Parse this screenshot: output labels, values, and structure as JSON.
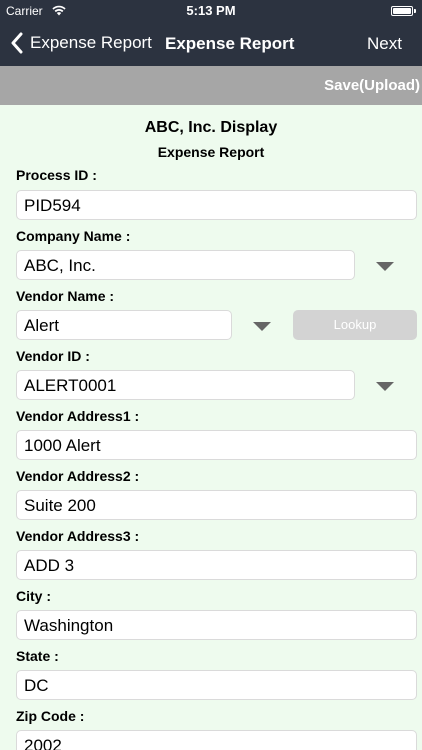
{
  "status_bar": {
    "carrier": "Carrier",
    "time": "5:13 PM"
  },
  "nav": {
    "back_label": "Expense Report",
    "title": "Expense Report",
    "next_label": "Next"
  },
  "toolbar": {
    "save_label": "Save(Upload)"
  },
  "form": {
    "heading": "ABC, Inc. Display",
    "subheading": "Expense Report",
    "process_id": {
      "label": "Process ID :",
      "value": "PID594"
    },
    "company_name": {
      "label": "Company Name :",
      "value": "ABC, Inc."
    },
    "vendor_name": {
      "label": "Vendor Name :",
      "value": "Alert",
      "lookup_label": "Lookup"
    },
    "vendor_id": {
      "label": "Vendor ID :",
      "value": "ALERT0001"
    },
    "vendor_address1": {
      "label": "Vendor Address1 :",
      "value": "1000 Alert"
    },
    "vendor_address2": {
      "label": "Vendor Address2 :",
      "value": "Suite 200"
    },
    "vendor_address3": {
      "label": "Vendor Address3 :",
      "value": "ADD 3"
    },
    "city": {
      "label": "City :",
      "value": "Washington"
    },
    "state": {
      "label": "State :",
      "value": "DC"
    },
    "zip_code": {
      "label": "Zip Code :",
      "value": "2002"
    }
  },
  "colors": {
    "nav_bg": "#2c3340",
    "toolbar_bg": "#a6a6a6",
    "page_bg": "#eefbee"
  }
}
